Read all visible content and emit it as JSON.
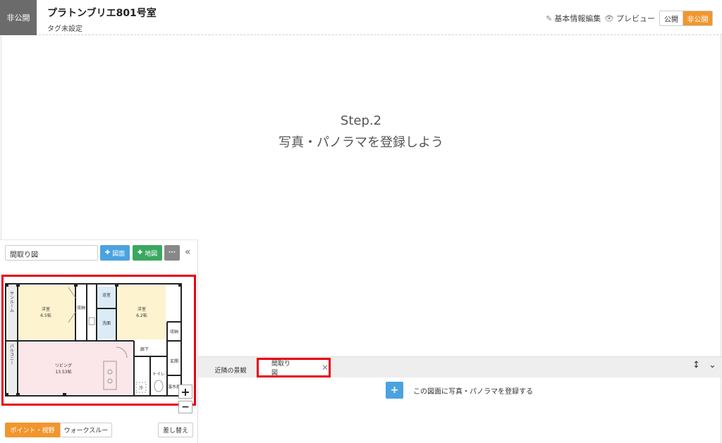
{
  "header": {
    "status": "非公開",
    "title": "プラトンブリエ801号室",
    "tag": "タグ未設定",
    "edit_label": "基本情報編集",
    "preview_label": "プレビュー",
    "toggle_public": "公開",
    "toggle_private": "非公開"
  },
  "viewer": {
    "step": "Step.2",
    "description": "写真・パノラマを登録しよう"
  },
  "floorplan": {
    "name": "間取り図",
    "add_floorplan_label": "図面",
    "add_map_label": "地図",
    "more_label": "···",
    "rooms": {
      "western1": "洋室",
      "western1_size": "6.5帖",
      "closet": "収納",
      "bath": "浴室",
      "washroom": "洗面",
      "western2": "洋室",
      "western2_size": "6.2帖",
      "sunroom": "サンルーム",
      "living": "リビング",
      "living_size": "13.53帖",
      "hallway": "廊下",
      "closet2": "収納",
      "entrance": "玄関",
      "toilet": "トイレ",
      "fridge": "冷",
      "water_heater": "温水器",
      "balcony": "バルコニー"
    },
    "mode_point": "ポイント・視野",
    "mode_walk": "ウォークスルー",
    "replace_label": "差し替え"
  },
  "tabs": {
    "items": [
      "近隣の景観",
      "間取り図"
    ],
    "add_text": "この図面に写真・パノラマを登録する"
  },
  "colors": {
    "accent": "#f0962d",
    "highlight": "#e60012",
    "blue": "#4aa3df",
    "green": "#3aa760"
  }
}
